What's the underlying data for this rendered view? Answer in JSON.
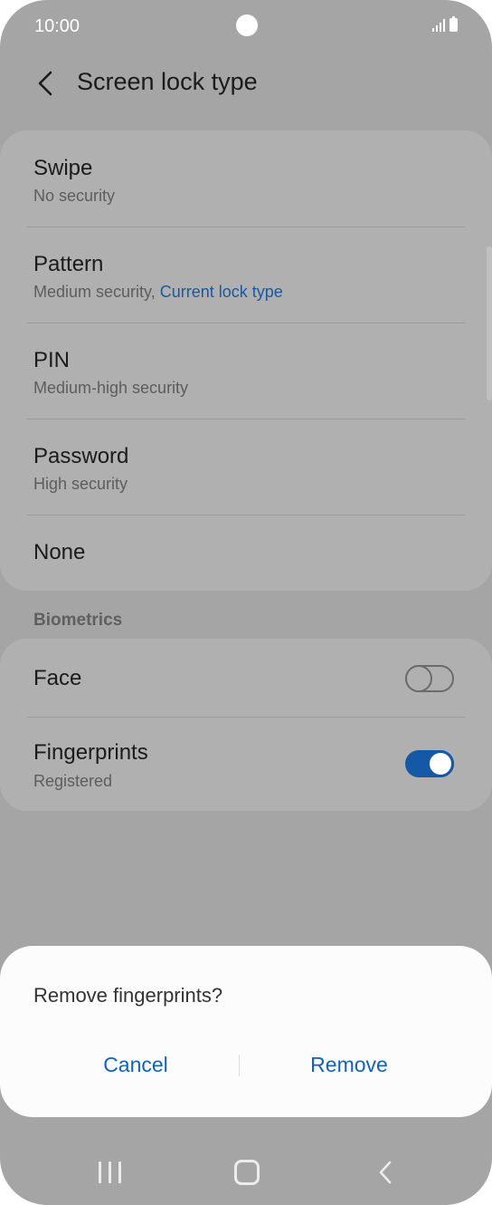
{
  "status_bar": {
    "time": "10:00"
  },
  "header": {
    "title": "Screen lock type"
  },
  "lock_types": [
    {
      "label": "Swipe",
      "sub": "No security"
    },
    {
      "label": "Pattern",
      "sub": "Medium security,",
      "sub_accent": "Current lock type"
    },
    {
      "label": "PIN",
      "sub": "Medium-high security"
    },
    {
      "label": "Password",
      "sub": "High security"
    },
    {
      "label": "None"
    }
  ],
  "biometrics": {
    "header": "Biometrics",
    "items": [
      {
        "label": "Face",
        "toggle": "off"
      },
      {
        "label": "Fingerprints",
        "sub": "Registered",
        "toggle": "on"
      }
    ]
  },
  "dialog": {
    "message": "Remove fingerprints?",
    "cancel_label": "Cancel",
    "remove_label": "Remove"
  },
  "colors": {
    "accent": "#1559a6",
    "dialog_button": "#1163b9",
    "dim_background": "#a5a5a5"
  },
  "icons": {
    "back": "chevron-left-icon",
    "recents": "recents-icon",
    "home": "home-icon",
    "nav_back": "chevron-left-icon"
  }
}
